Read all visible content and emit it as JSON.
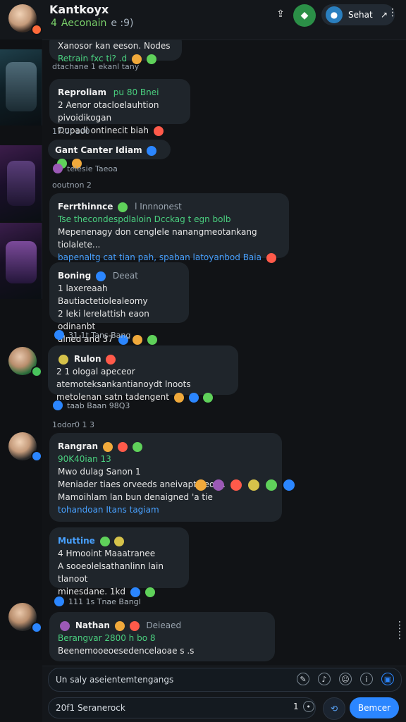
{
  "header": {
    "title": "Kantkoyx",
    "status_prefix": "4",
    "status_text": "Aeconain",
    "status_suffix": "e :9)",
    "pill_label": "Sehat",
    "pill_icon": "↗"
  },
  "messages": [
    {
      "id": "m0",
      "lines": [
        "Xanosor kan  eeson. Nodes",
        "Retrain  fxc  ti? .d"
      ],
      "meta": "dtachane 1 ekanl tany"
    },
    {
      "id": "m1",
      "name": "Reproliam",
      "name_suffix": "pu 80 Bnei",
      "body": [
        "2 Aenor otacloelauhtion  pivoidikogan",
        "Dupadl ontinecit biah"
      ],
      "meta": "17:0t  100"
    },
    {
      "id": "m2",
      "name": "Gant Canter Idiam",
      "meta": "telesie   Taeoa"
    },
    {
      "id": "m3",
      "timestamp": "ooutnon 2",
      "name": "Ferrthinnce",
      "name_suffix": "l Innnonest",
      "lines": [
        "Tse thecondespdlaloin Dcckag t egn bolb",
        "Mepenenagy don cenglele nanangmeotankang tiolalete...",
        "bapenaltg cat tian pah, spaban latoyanbod  Baia"
      ]
    },
    {
      "id": "m4",
      "name": "Boning",
      "name_suffix": "Deeat",
      "lines": [
        "1 laxereaah Bautiactetiolealeomy",
        "2 leki lerelattish eaon odinanbt",
        "alned and  37"
      ],
      "meta": "31 1t    Tans   Bang"
    },
    {
      "id": "m5",
      "name": "Rulon",
      "lines": [
        "2 1 ologal apeceor atemoteksankantianoydt lnoots",
        "metolenan  satn tadengent"
      ],
      "meta": "taab   Baan   98Q3"
    },
    {
      "id": "m6",
      "timestamp": "1odor0 1 3",
      "name": "Rangran",
      "lines": [
        "90K40ian 13",
        "Mwo dulag   Sanon 1",
        "Meniader  tiaes orveeds aneivaptaleom.",
        "Mamoihlam lan bun  denaigned 'a  tie",
        "tohandoan  Itans tagiam"
      ]
    },
    {
      "id": "m7",
      "name": "Muttine",
      "lines": [
        "4 Hmooint  Maaatranee",
        "A sooeolelsathanlinn  lain tlanoot",
        "minesdane.  1kd"
      ],
      "meta": "111 1s   Tnae   Bangl"
    },
    {
      "id": "m8",
      "name": "Nathan",
      "name_suffix": "Deieaed",
      "lines": [
        "Berangvar 2800 h bo 8",
        "Beenemooeoesedencelaoae s .s"
      ]
    }
  ],
  "composer": {
    "primary_placeholder": "Un  saly  aseientemtengangs",
    "secondary_placeholder": "20f1  Seranerock",
    "counter": "1",
    "send_label": "Bemcer"
  },
  "colors": {
    "accent_blue": "#2b86ff",
    "accent_green": "#2b8f47",
    "bubble_bg": "#1f252b",
    "background": "#111316"
  },
  "icons": [
    "share-icon",
    "gamepad-icon",
    "settings-icon",
    "more-icon",
    "attach-icon",
    "mic-icon",
    "emoji-icon",
    "info-icon",
    "image-icon",
    "send-icon"
  ]
}
